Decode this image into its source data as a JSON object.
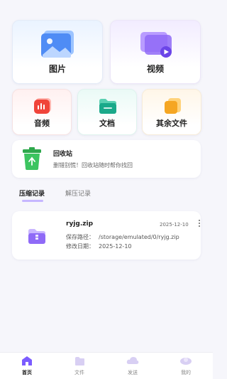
{
  "categories": {
    "images": {
      "label": "图片",
      "icon": "image-icon"
    },
    "videos": {
      "label": "视频",
      "icon": "video-icon"
    },
    "audio": {
      "label": "音频",
      "icon": "audio-icon"
    },
    "documents": {
      "label": "文档",
      "icon": "folder-icon"
    },
    "others": {
      "label": "其余文件",
      "icon": "other-files-icon"
    }
  },
  "recycle_bin": {
    "title": "回收站",
    "description": "删错别慌！回收站随时帮你找回",
    "icon": "recycle-bin-icon"
  },
  "tabs": [
    {
      "label": "压缩记录",
      "active": true
    },
    {
      "label": "解压记录",
      "active": false
    }
  ],
  "records": [
    {
      "name": "ryjg.zip",
      "date": "2025-12-10",
      "path_label": "保存路径：",
      "path": "/storage/emulated/0/ryjg.zip",
      "modified_label": "修改日期：",
      "modified": "2025-12-10",
      "icon": "zip-folder-icon"
    }
  ],
  "bottom_nav": [
    {
      "label": "首页",
      "icon": "home-icon",
      "active": true
    },
    {
      "label": "文件",
      "icon": "file-icon",
      "active": false
    },
    {
      "label": "发送",
      "icon": "send-icon",
      "active": false
    },
    {
      "label": "我的",
      "icon": "profile-icon",
      "active": false
    }
  ],
  "colors": {
    "accent": "#7b5cff",
    "recycle_green": "#2ea84c",
    "audio_red": "#f0443a",
    "doc_teal": "#1aa98a",
    "other_orange": "#f5a623"
  }
}
